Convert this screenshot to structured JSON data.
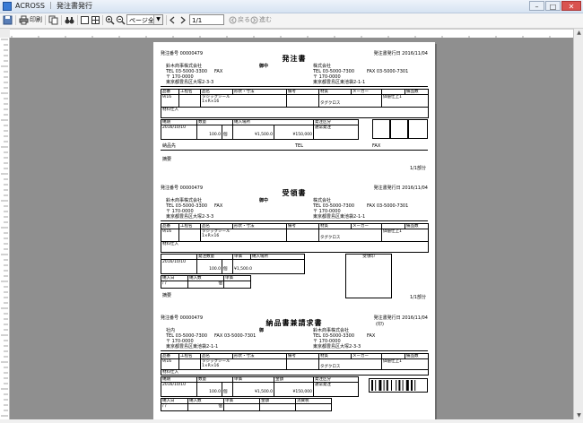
{
  "window": {
    "title": "ACROSS ｜ 発注書発行"
  },
  "toolbar": {
    "print_label": "印刷",
    "zoom_select": "ページ全体",
    "page_value": "1/1",
    "back_label": "戻る",
    "forward_label": "進む"
  },
  "forms": [
    {
      "title": "発注書",
      "order_no": "発注番号 00000479",
      "date": "発注書発行日 2016/11/04",
      "company": "鈴木商事株式会社",
      "tel": "TEL 03-5000-3300",
      "postal": "〒 170-0000",
      "address": "東京都豊島区大塚2-3-3",
      "fax": "FAX",
      "onchu": "御中",
      "right_block": [
        "株式会社",
        "TEL 03-5000-7300",
        "〒 170-0000",
        "東京都豊島区東池袋2-1-1"
      ],
      "right_fax": "FAX 03-5000-7301",
      "header_cells": [
        "品番",
        "工程名",
        "品名",
        "形状・寸法",
        "備考",
        "材質",
        "メーカー",
        "",
        "備品数"
      ],
      "row1": [
        "9/16",
        "",
        "タジックシール",
        "1×R×16",
        "",
        "タグクロス",
        "",
        "価値仕上1",
        ""
      ],
      "row2": "材料仕入",
      "sub_header": [
        "納期",
        "数量",
        "",
        "",
        "納入場所",
        "",
        "発注区分"
      ],
      "sub_row": [
        "2016/10/10",
        "",
        "100.0",
        "個",
        "¥1,500.0",
        "¥150,000",
        "",
        "通常発注"
      ],
      "remark1": "納品先",
      "tel_label": "TEL",
      "fax_label": "FAX",
      "remark2": "摘要",
      "pages": "1/1部分"
    },
    {
      "title": "受領書",
      "order_no": "発注番号 00000479",
      "date": "発注書発行日 2016/11/04",
      "company": "鈴木商事株式会社",
      "tel": "TEL 03-5000-3300",
      "postal": "〒 170-0000",
      "address": "東京都豊島区大塚2-3-3",
      "fax": "FAX",
      "onchu": "御中",
      "right_block": [
        "株式会社",
        "TEL 03-5000-7300",
        "〒 170-0000",
        "東京都豊島区東池袋2-1-1"
      ],
      "right_fax": "FAX 03-5000-7301",
      "header_cells": [
        "品番",
        "工程名",
        "品名",
        "形状・寸法",
        "備考",
        "材質",
        "メーカー",
        "",
        "備品数"
      ],
      "row1": [
        "9/16",
        "",
        "タジックシール",
        "1×R×16",
        "",
        "タグクロス",
        "",
        "価値仕上1",
        ""
      ],
      "row2": "材料仕入",
      "sub_header": [
        "発注数量",
        "",
        "単価",
        "",
        "納入場所"
      ],
      "sub_row": [
        "2016/10/10",
        "",
        "100.0",
        "個",
        "¥1,500.0"
      ],
      "recv": [
        "納入日",
        "納入数",
        "単価"
      ],
      "recv_row": [
        "/ /",
        "",
        "個"
      ],
      "stamp": "受領印",
      "remark2": "摘要",
      "pages": "1/1部分"
    },
    {
      "title": "納品書兼請求書",
      "order_no": "発注番号 00000479",
      "date": "発注書発行日 2016/11/04",
      "sub_date": "(印)",
      "company": "社内",
      "tel": "TEL 03-5000-7300",
      "postal": "〒 170-0000",
      "address": "東京都豊島区東池袋2-1-1",
      "fax": "FAX 03-5000-7301",
      "onchu": "御",
      "right_block": [
        "鈴木商事株式会社",
        "TEL 03-5000-3300",
        "〒 170-0000",
        "東京都豊島区大塚2-3-3"
      ],
      "right_fax": "FAX",
      "header_cells": [
        "品番",
        "工程名",
        "品名",
        "形状・寸法",
        "備考",
        "材質",
        "メーカー",
        "",
        "備品数"
      ],
      "row1": [
        "9/16",
        "",
        "タジックシール",
        "1×R×16",
        "",
        "タグクロス",
        "",
        "価値仕上1",
        ""
      ],
      "row2": "材料仕入",
      "sub_header": [
        "納期",
        "数量",
        "単価",
        "金額",
        "発注区分"
      ],
      "sub_row": [
        "2016/10/10",
        "",
        "100.0",
        "個",
        "¥1,500.0",
        "¥150,000",
        "通常発注"
      ],
      "recv": [
        "納入日",
        "納入数",
        "単価",
        "金額",
        "消費税"
      ],
      "recv_row": [
        "/ /",
        "",
        "個"
      ]
    }
  ]
}
